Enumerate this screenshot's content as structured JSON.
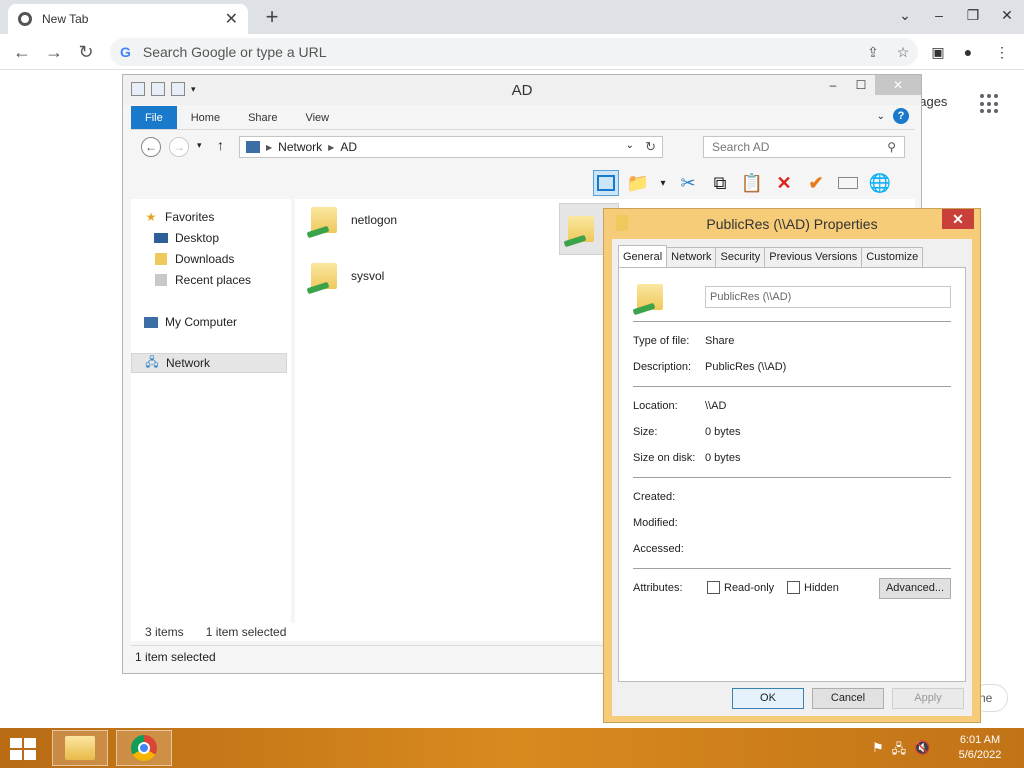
{
  "browser": {
    "tab_title": "New Tab",
    "tab_close": "✕",
    "new_tab": "+",
    "omnibox_placeholder": "Search Google or type a URL",
    "images_link": "nages",
    "customize_peek": "ne"
  },
  "explorer": {
    "title": "AD",
    "ribbon_tabs": [
      "File",
      "Home",
      "Share",
      "View"
    ],
    "breadcrumb": [
      "Network",
      "AD"
    ],
    "search_placeholder": "Search AD",
    "nav": {
      "favorites": "Favorites",
      "desktop": "Desktop",
      "downloads": "Downloads",
      "recent": "Recent places",
      "computer": "My Computer",
      "network": "Network"
    },
    "files": [
      {
        "name": "netlogon"
      },
      {
        "name": "sysvol"
      },
      {
        "name": ""
      }
    ],
    "status_items": "3 items",
    "status_selected": "1 item selected",
    "status_bar": "1 item selected"
  },
  "properties": {
    "title": "PublicRes (\\\\AD) Properties",
    "tabs": [
      "General",
      "Network",
      "Security",
      "Previous Versions",
      "Customize"
    ],
    "name_value": "PublicRes (\\\\AD)",
    "labels": {
      "type": "Type of file:",
      "description": "Description:",
      "location": "Location:",
      "size": "Size:",
      "size_on_disk": "Size on disk:",
      "created": "Created:",
      "modified": "Modified:",
      "accessed": "Accessed:",
      "attributes": "Attributes:"
    },
    "values": {
      "type": "Share",
      "description": "PublicRes (\\\\AD)",
      "location": "\\\\AD",
      "size": "0 bytes",
      "size_on_disk": "0 bytes"
    },
    "readonly": "Read-only",
    "hidden": "Hidden",
    "advanced": "Advanced...",
    "ok": "OK",
    "cancel": "Cancel",
    "apply": "Apply"
  },
  "taskbar": {
    "time": "6:01 AM",
    "date": "5/6/2022"
  }
}
